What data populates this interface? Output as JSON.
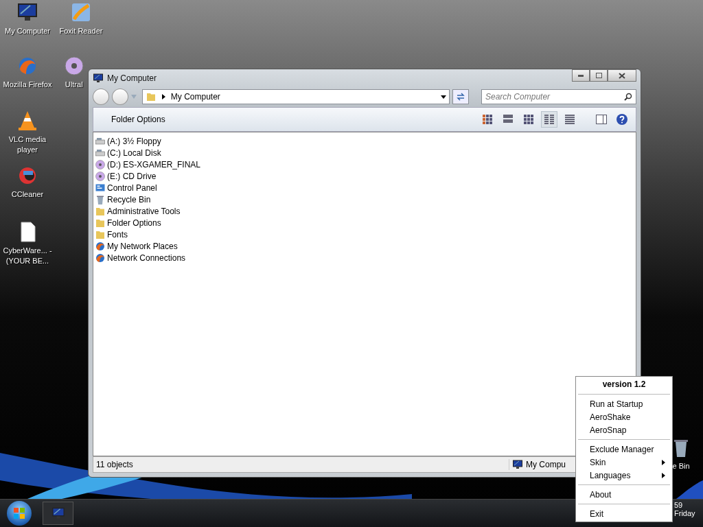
{
  "desktop_icons": [
    {
      "label": "My Computer",
      "kind": "monitor"
    },
    {
      "label": "Foxit Reader",
      "kind": "pen"
    },
    {
      "label": "Mozilla Firefox",
      "kind": "globe"
    },
    {
      "label": "UltraI",
      "kind": "disc"
    },
    {
      "label": "VLC media player",
      "kind": "cone"
    },
    {
      "label": "CCleaner",
      "kind": "cleaner"
    },
    {
      "label": "CyberWare... - (YOUR BE...",
      "kind": "file"
    },
    {
      "label": "e Bin",
      "kind": "bin"
    }
  ],
  "window": {
    "title": "My Computer",
    "address": "My Computer",
    "search": {
      "placeholder": "Search Computer"
    },
    "toolbar": {
      "label": "Folder Options",
      "views": [
        {
          "kind": "thumbs",
          "selected": false
        },
        {
          "kind": "tiles",
          "selected": false
        },
        {
          "kind": "icons",
          "selected": false
        },
        {
          "kind": "list",
          "selected": true
        },
        {
          "kind": "details",
          "selected": false
        }
      ]
    },
    "items": [
      {
        "label": "(A:) 3½ Floppy",
        "kind": "drive"
      },
      {
        "label": "(C:) Local Disk",
        "kind": "drive"
      },
      {
        "label": "(D:) ES-XGAMER_FINAL",
        "kind": "disc"
      },
      {
        "label": "(E:) CD Drive",
        "kind": "disc"
      },
      {
        "label": "Control Panel",
        "kind": "panel"
      },
      {
        "label": "Recycle Bin",
        "kind": "bin"
      },
      {
        "label": "Administrative Tools",
        "kind": "folder"
      },
      {
        "label": "Folder Options",
        "kind": "folder"
      },
      {
        "label": "Fonts",
        "kind": "folder"
      },
      {
        "label": "My Network Places",
        "kind": "globe"
      },
      {
        "label": "Network Connections",
        "kind": "globe"
      }
    ],
    "status": {
      "count": "11 objects",
      "location": "My Compu"
    }
  },
  "context_menu": {
    "header": "version 1.2",
    "groups": [
      [
        {
          "label": "Run at Startup",
          "submenu": false
        },
        {
          "label": "AeroShake",
          "submenu": false
        },
        {
          "label": "AeroSnap",
          "submenu": false
        }
      ],
      [
        {
          "label": "Exclude Manager",
          "submenu": false
        },
        {
          "label": "Skin",
          "submenu": true
        },
        {
          "label": "Languages",
          "submenu": true
        }
      ],
      [
        {
          "label": "About",
          "submenu": false
        }
      ],
      [
        {
          "label": "Exit",
          "submenu": false
        }
      ]
    ]
  },
  "taskbar": {
    "clock": {
      "time": "59",
      "day": "Friday"
    }
  }
}
